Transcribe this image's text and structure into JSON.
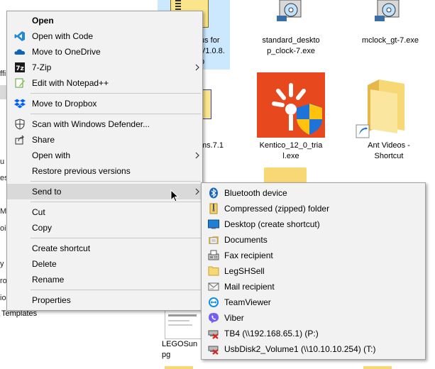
{
  "explorer": {
    "sidebar_fragments": [
      "ffi",
      "u",
      "es",
      "M",
      "oi",
      "y",
      "ro",
      "io"
    ],
    "templates_label": "Templates",
    "files": [
      {
        "label": "us for\nV1.0.8.\np",
        "icon": "zip-file-icon"
      },
      {
        "label": "standard_deskto\np_clock-7.exe",
        "icon": "installer-icon"
      },
      {
        "label": "mclock_gt-7.exe",
        "icon": "installer-icon"
      },
      {
        "label": "ms.7.1",
        "icon": "zip-file-icon"
      },
      {
        "label": "Kentico_12_0_tria\nl.exe",
        "icon": "kentico-icon"
      },
      {
        "label": "Ant Videos -\nShortcut",
        "icon": "folder-shortcut-icon"
      },
      {
        "label": "LEGOSun\npg",
        "icon": "image-icon"
      }
    ]
  },
  "context_menu": {
    "open": "Open",
    "open_with_code": "Open with Code",
    "move_to_onedrive": "Move to OneDrive",
    "seven_zip": "7-Zip",
    "edit_notepadpp": "Edit with Notepad++",
    "move_to_dropbox": "Move to Dropbox",
    "scan_defender": "Scan with Windows Defender...",
    "share": "Share",
    "open_with": "Open with",
    "restore_versions": "Restore previous versions",
    "send_to": "Send to",
    "cut": "Cut",
    "copy": "Copy",
    "create_shortcut": "Create shortcut",
    "delete": "Delete",
    "rename": "Rename",
    "properties": "Properties"
  },
  "send_to_menu": {
    "items": [
      {
        "label": "Bluetooth device",
        "icon": "bluetooth-icon"
      },
      {
        "label": "Compressed (zipped) folder",
        "icon": "zip-folder-icon"
      },
      {
        "label": "Desktop (create shortcut)",
        "icon": "desktop-icon"
      },
      {
        "label": "Documents",
        "icon": "documents-icon"
      },
      {
        "label": "Fax recipient",
        "icon": "fax-icon"
      },
      {
        "label": "LegSHSell",
        "icon": "folder-icon"
      },
      {
        "label": "Mail recipient",
        "icon": "mail-icon"
      },
      {
        "label": "TeamViewer",
        "icon": "teamviewer-icon"
      },
      {
        "label": "Viber",
        "icon": "viber-icon"
      },
      {
        "label": "TB4 (\\\\192.168.65.1) (P:)",
        "icon": "disconnected-drive-icon"
      },
      {
        "label": "UsbDisk2_Volume1 (\\\\10.10.10.254) (T:)",
        "icon": "disconnected-drive-icon"
      }
    ]
  },
  "colors": {
    "menu_bg": "#f2f2f2",
    "highlight": "#d9d9d9",
    "selection_tile": "#cce8ff",
    "kentico_orange": "#e8481d"
  }
}
